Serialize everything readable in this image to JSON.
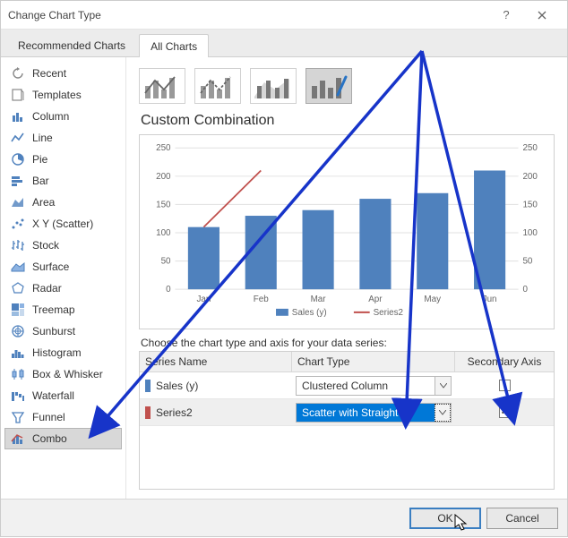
{
  "title": "Change Chart Type",
  "tabs": {
    "recommended": "Recommended Charts",
    "all": "All Charts"
  },
  "sidebar": {
    "items": [
      {
        "label": "Recent"
      },
      {
        "label": "Templates"
      },
      {
        "label": "Column"
      },
      {
        "label": "Line"
      },
      {
        "label": "Pie"
      },
      {
        "label": "Bar"
      },
      {
        "label": "Area"
      },
      {
        "label": "X Y (Scatter)"
      },
      {
        "label": "Stock"
      },
      {
        "label": "Surface"
      },
      {
        "label": "Radar"
      },
      {
        "label": "Treemap"
      },
      {
        "label": "Sunburst"
      },
      {
        "label": "Histogram"
      },
      {
        "label": "Box & Whisker"
      },
      {
        "label": "Waterfall"
      },
      {
        "label": "Funnel"
      },
      {
        "label": "Combo"
      }
    ]
  },
  "section_title": "Custom Combination",
  "series_label": "Choose the chart type and axis for your data series:",
  "series_columns": {
    "name": "Series Name",
    "type": "Chart Type",
    "secondary": "Secondary Axis"
  },
  "series": [
    {
      "name": "Sales (y)",
      "type": "Clustered Column",
      "color": "#4f81bd",
      "secondary": false
    },
    {
      "name": "Series2",
      "type": "Scatter with Straight ...",
      "color": "#c0504d",
      "secondary": true
    }
  ],
  "legend": {
    "s1": "Sales (y)",
    "s2": "Series2"
  },
  "buttons": {
    "ok": "OK",
    "cancel": "Cancel"
  },
  "chart_data": {
    "type": "bar",
    "categories": [
      "Jan",
      "Feb",
      "Mar",
      "Apr",
      "May",
      "Jun"
    ],
    "series": [
      {
        "name": "Sales (y)",
        "type": "bar",
        "values": [
          110,
          130,
          140,
          160,
          170,
          210
        ],
        "color": "#4f81bd",
        "axis": "primary"
      },
      {
        "name": "Series2",
        "type": "line",
        "x": [
          1,
          2
        ],
        "y": [
          110,
          210
        ],
        "color": "#c0504d",
        "axis": "secondary"
      }
    ],
    "title": "",
    "xlabel": "",
    "ylabel": "",
    "ylim_primary": [
      0,
      250
    ],
    "ylim_secondary": [
      0,
      250
    ],
    "yticks": [
      0,
      50,
      100,
      150,
      200,
      250
    ]
  }
}
